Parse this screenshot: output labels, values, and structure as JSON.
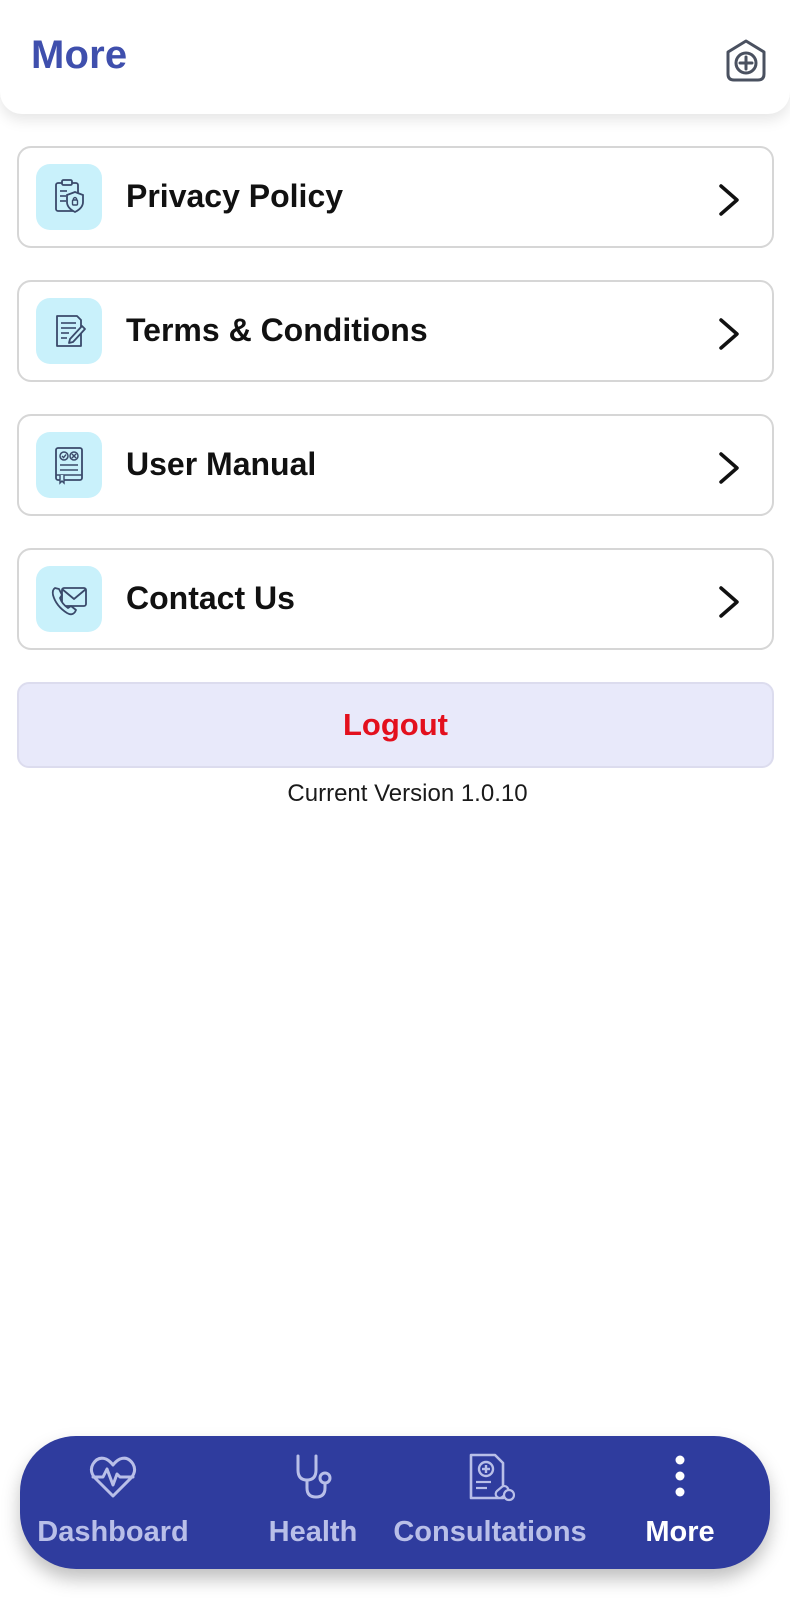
{
  "header": {
    "title": "More",
    "action_icon": "add-hospital-icon"
  },
  "menu": {
    "items": [
      {
        "label": "Privacy Policy",
        "icon": "privacy-clipboard-shield-icon"
      },
      {
        "label": "Terms & Conditions",
        "icon": "document-pen-icon"
      },
      {
        "label": "User Manual",
        "icon": "guide-book-icon"
      },
      {
        "label": "Contact Us",
        "icon": "phone-envelope-icon"
      }
    ]
  },
  "logout": {
    "label": "Logout"
  },
  "version_text": "Current Version 1.0.10",
  "bottom_nav": {
    "items": [
      {
        "label": "Dashboard",
        "icon": "heart-pulse-icon",
        "active": false
      },
      {
        "label": "Health",
        "icon": "stethoscope-icon",
        "active": false
      },
      {
        "label": "Consultations",
        "icon": "prescription-icon",
        "active": false
      },
      {
        "label": "More",
        "icon": "vertical-dots-icon",
        "active": true
      }
    ]
  },
  "colors": {
    "brand": "#3f4fad",
    "nav_background": "#2f3c9e",
    "icon_tile": "#c9f1fb",
    "logout_text": "#e3101d",
    "logout_background": "#e8e9fa"
  }
}
